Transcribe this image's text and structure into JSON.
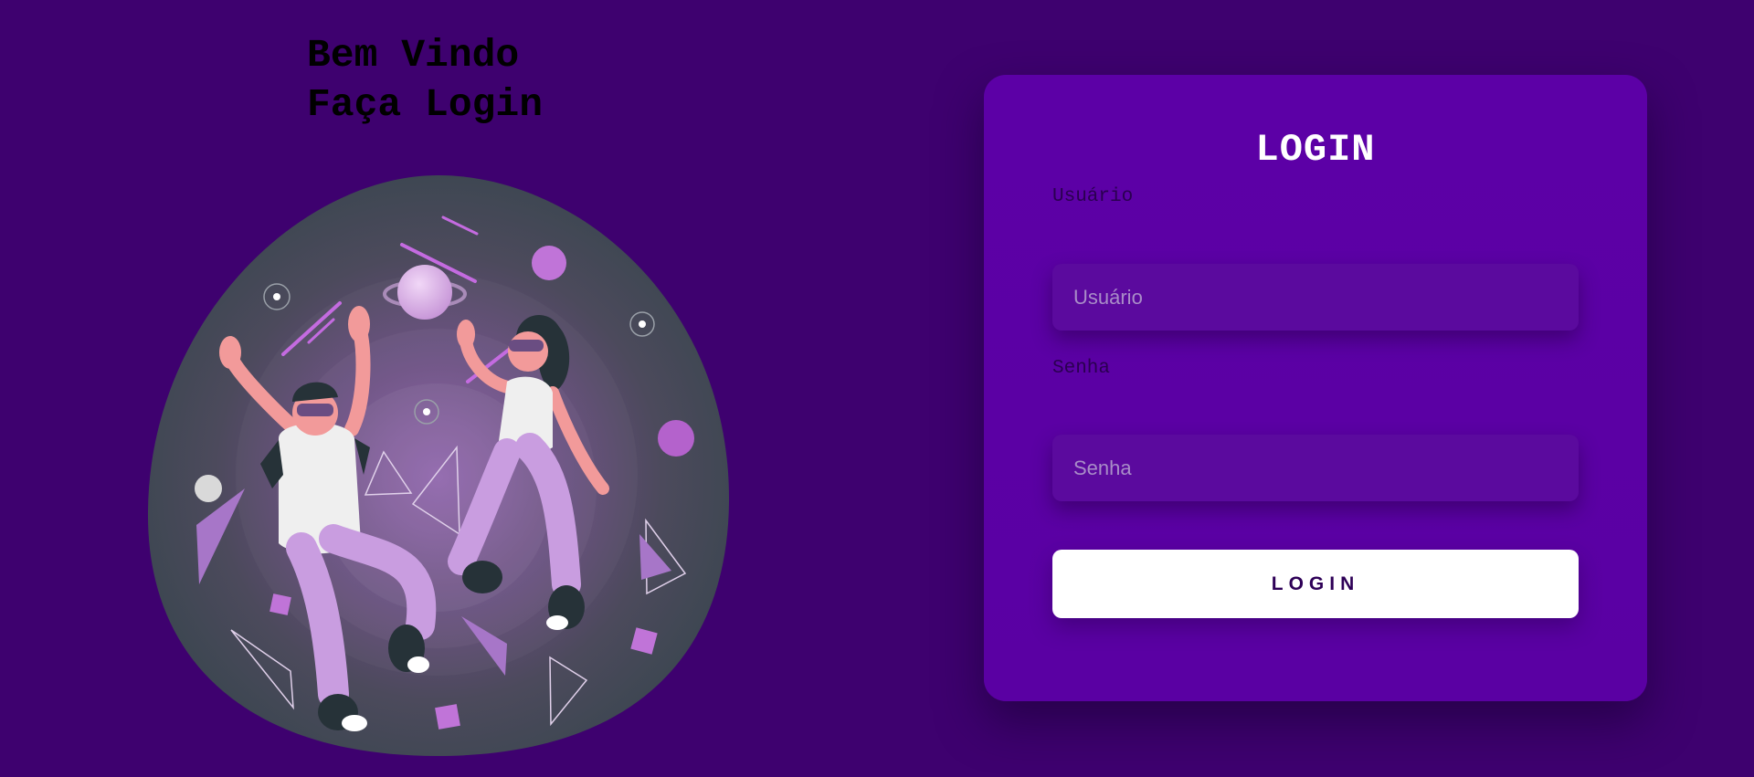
{
  "welcome": {
    "line1": "Bem Vindo",
    "line2": "Faça Login"
  },
  "illustration": {
    "description_icon": "vr-space-illustration-icon"
  },
  "login_card": {
    "title": "LOGIN",
    "username_label": "Usuário",
    "username_placeholder": "Usuário",
    "username_value": "",
    "password_label": "Senha",
    "password_placeholder": "Senha",
    "password_value": "",
    "submit_label": "LOGIN"
  },
  "colors": {
    "background": "#3e016f",
    "card": "#5c00a6",
    "input": "#5b0a9e",
    "button": "#ffffff",
    "button_text": "#2e0057"
  }
}
